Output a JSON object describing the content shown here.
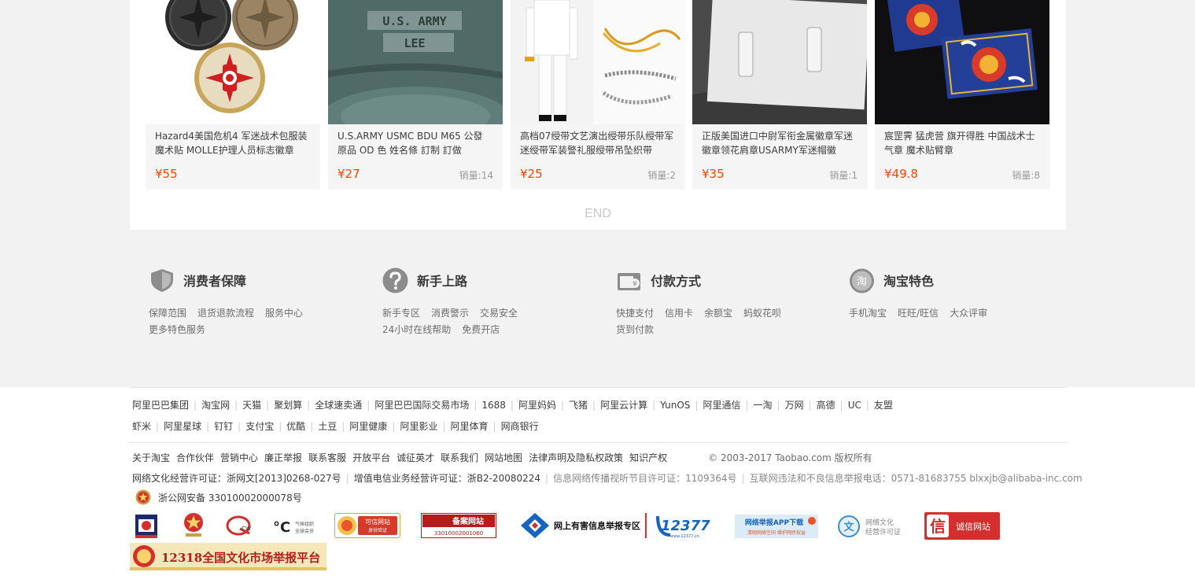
{
  "products": [
    {
      "title": "Hazard4美国危机4 军迷战术包服装魔术贴 MOLLE护理人员标志徽章",
      "price": "¥55",
      "sold": ""
    },
    {
      "title": "U.S.ARMY USMC BDU M65 公發 原品 OD 色 姓名條 訂制 訂做",
      "price": "¥27",
      "sold": "销量:14",
      "thumb_text_1": "U.S. ARMY",
      "thumb_text_2": "LEE"
    },
    {
      "title": "高档07绶带文艺演出绶带乐队绶带军迷绶带军装警礼服绶带吊坠织带",
      "price": "¥25",
      "sold": "销量:2"
    },
    {
      "title": "正版美国进口中尉军衔金属徽章军迷徽章领花肩章USARMY军迷帽徽",
      "price": "¥35",
      "sold": "销量:1"
    },
    {
      "title": "宸罡霁 猛虎营 旗开得胜 中国战术士气章 魔术贴臂章",
      "price": "¥49.8",
      "sold": "销量:8"
    }
  ],
  "end_label": "END",
  "services": [
    {
      "title": "消费者保障",
      "icon": "shield-icon",
      "links": [
        "保障范围",
        "退货退款流程",
        "服务中心",
        "更多特色服务"
      ]
    },
    {
      "title": "新手上路",
      "icon": "question-icon",
      "links": [
        "新手专区",
        "消费警示",
        "交易安全",
        "24小时在线帮助",
        "免费开店"
      ]
    },
    {
      "title": "付款方式",
      "icon": "wallet-icon",
      "links": [
        "快捷支付",
        "信用卡",
        "余额宝",
        "蚂蚁花呗",
        "货到付款"
      ]
    },
    {
      "title": "淘宝特色",
      "icon": "taobao-icon",
      "icon_char": "淘",
      "links": [
        "手机淘宝",
        "旺旺/旺信",
        "大众评审"
      ]
    }
  ],
  "group_links_row1": [
    "阿里巴巴集团",
    "淘宝网",
    "天猫",
    "聚划算",
    "全球速卖通",
    "阿里巴巴国际交易市场",
    "1688",
    "阿里妈妈",
    "飞猪",
    "阿里云计算",
    "YunOS",
    "阿里通信",
    "一淘",
    "万网",
    "高德",
    "UC",
    "友盟"
  ],
  "group_links_row2": [
    "虾米",
    "阿里星球",
    "钉钉",
    "支付宝",
    "优酷",
    "土豆",
    "阿里健康",
    "阿里影业",
    "阿里体育",
    "网商银行"
  ],
  "about_links": [
    "关于淘宝",
    "合作伙伴",
    "营销中心",
    "廉正举报",
    "联系客服",
    "开放平台",
    "诚征英才",
    "联系我们",
    "网站地图",
    "法律声明及隐私权政策",
    "知识产权"
  ],
  "copyright": "© 2003-2017 Taobao.com 版权所有",
  "license": {
    "culture": "网络文化经营许可证：浙网文[2013]0268-027号",
    "telecom": "增值电信业务经营许可证：浙B2-20080224",
    "av": "信息网络传播视听节目许可证：1109364号",
    "report": "互联网违法和不良信息举报电话：0571-81683755 blxxjb@alibaba-inc.com"
  },
  "beian": "浙公网安备 33010002000078号",
  "badges": {
    "kexin": "可信网站",
    "kexin_sub": "身份验证",
    "beian_title": "备案网站",
    "beian_num": "33010002001060",
    "harmful": "网上有害信息举报专区",
    "num_12377": "12377",
    "app_title": "网络举报APP下载",
    "app_sub": "清朗网络空间 维护网民权益",
    "culture_title": "网络文化",
    "culture_sub": "经营许可证",
    "chengxin": "诚信网站",
    "market": "12318全国文化市场举报平台",
    "ic_label": "气候组织全球会员"
  },
  "colors": {
    "price": "#ff4400",
    "bg": "#f2f2f2",
    "text": "#3c3c3c"
  }
}
